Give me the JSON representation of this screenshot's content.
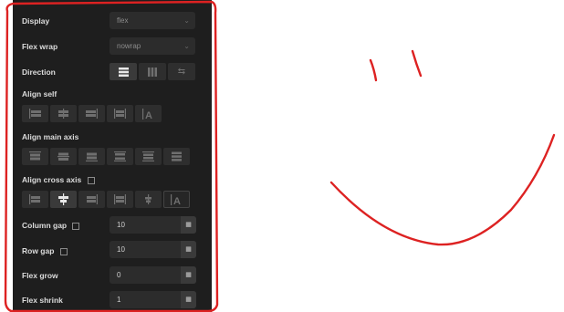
{
  "panel": {
    "display": {
      "label": "Display",
      "value": "flex"
    },
    "flex_wrap": {
      "label": "Flex wrap",
      "value": "nowrap"
    },
    "direction": {
      "label": "Direction"
    },
    "align_self": {
      "label": "Align self"
    },
    "align_main": {
      "label": "Align main axis"
    },
    "align_cross": {
      "label": "Align cross axis"
    },
    "column_gap": {
      "label": "Column gap",
      "value": "10"
    },
    "row_gap": {
      "label": "Row gap",
      "value": "10"
    },
    "flex_grow": {
      "label": "Flex grow",
      "value": "0"
    },
    "flex_shrink": {
      "label": "Flex shrink",
      "value": "1"
    }
  },
  "annotation": {
    "stroke_color": "#dd2222"
  },
  "colors": {
    "panel_bg": "#1e1e1e",
    "control_bg": "#2c2c2c",
    "label": "#dcdcdc"
  }
}
